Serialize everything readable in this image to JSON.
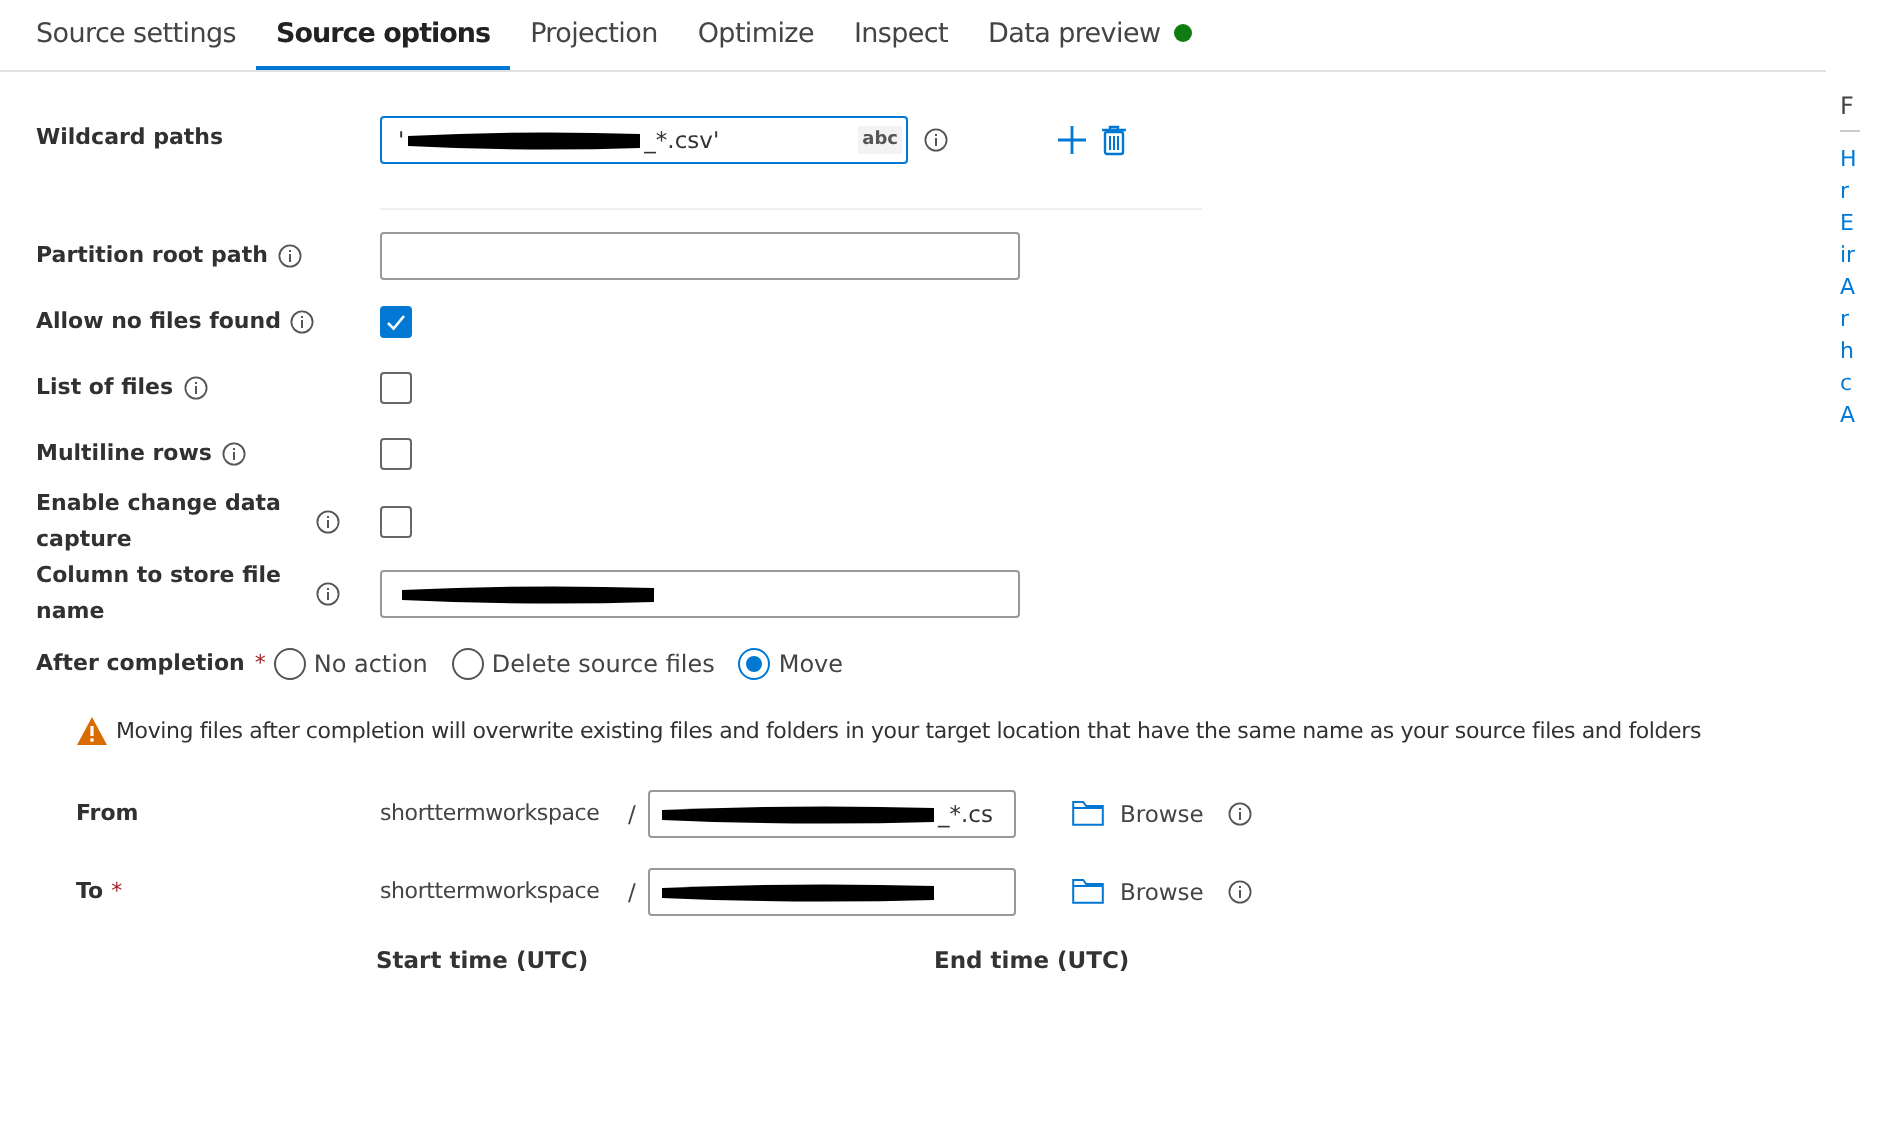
{
  "tabs": [
    {
      "label": "Source settings",
      "selected": false,
      "status": false
    },
    {
      "label": "Source options",
      "selected": true,
      "status": false
    },
    {
      "label": "Projection",
      "selected": false,
      "status": false
    },
    {
      "label": "Optimize",
      "selected": false,
      "status": false
    },
    {
      "label": "Inspect",
      "selected": false,
      "status": false
    },
    {
      "label": "Data preview",
      "selected": false,
      "status": true
    }
  ],
  "rows": [
    {
      "kind": "wildcard",
      "label": "Wildcard paths",
      "info": false,
      "value_start": "'",
      "redacted": true,
      "value_end": "_*.csv'",
      "badge": "abc"
    },
    {
      "kind": "field",
      "label": "Partition root path",
      "info": true,
      "redacted": false
    },
    {
      "kind": "checkbox",
      "label": "Allow no files found",
      "info": true,
      "checked": true
    },
    {
      "kind": "checkbox",
      "label": "List of files",
      "info": true,
      "checked": false
    },
    {
      "kind": "checkbox",
      "label": "Multiline rows",
      "info": true,
      "checked": false
    },
    {
      "kind": "checkbox",
      "label": "Enable change data capture",
      "info": true,
      "checked": false
    },
    {
      "kind": "field",
      "label": "Column to store file name",
      "info": true,
      "redacted": true
    },
    {
      "kind": "radio",
      "label": "After completion",
      "required": "*",
      "options": [
        {
          "label": "No action",
          "selected": false
        },
        {
          "label": "Delete source files",
          "selected": false
        },
        {
          "label": "Move",
          "selected": true
        }
      ]
    }
  ],
  "warning": "Moving files after completion will overwrite existing files and folders in your target location that have the same name as your source files and folders",
  "move": [
    {
      "label": "From",
      "container": "shorttermworkspace",
      "separator": "/",
      "redacted": true,
      "value_end": "_*.cs",
      "browse": "Browse"
    },
    {
      "label": "To",
      "required": "*",
      "container": "shorttermworkspace",
      "separator": "/",
      "redacted": true,
      "browse": "Browse"
    }
  ],
  "time_labels": [
    "Start time (UTC)",
    "End time (UTC)"
  ],
  "side_panel": {
    "title": "F",
    "lines": [
      "H",
      "r",
      "E",
      "ir",
      "A",
      "r",
      "h",
      "c",
      "A"
    ]
  }
}
